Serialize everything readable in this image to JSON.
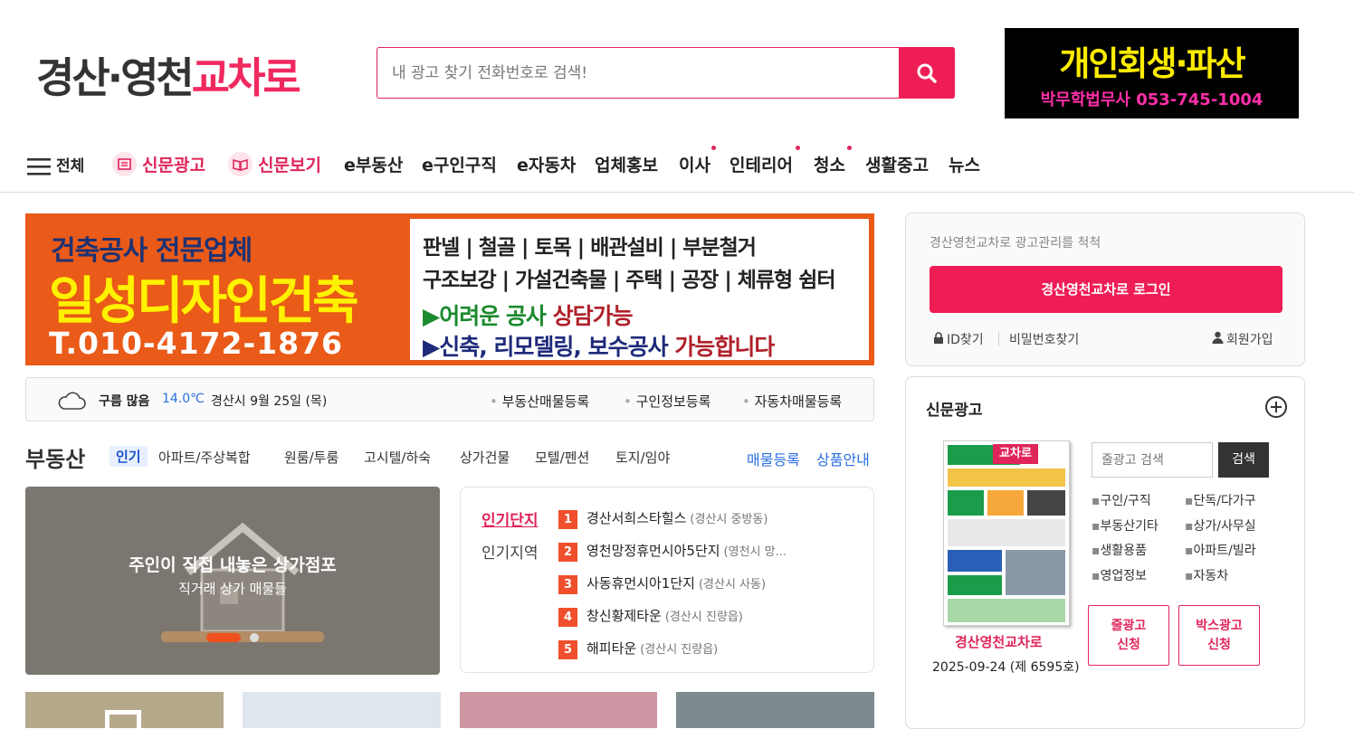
{
  "logo": {
    "part1": "경산·영천",
    "part2": "교차로"
  },
  "search": {
    "placeholder": "내 광고 찾기 전화번호로 검색!"
  },
  "top_ad": {
    "line1": "개인회생·파산",
    "line2": "박무학법무사 053-745-1004"
  },
  "nav": {
    "all": "전체",
    "items": [
      "신문광고",
      "신문보기",
      "e부동산",
      "e구인구직",
      "e자동차",
      "업체홍보",
      "이사",
      "인테리어",
      "청소",
      "생활중고",
      "뉴스"
    ]
  },
  "banner": {
    "l1": "건축공사 전문업체",
    "l2": "일성디자인건축",
    "l3": "T.010-4172-1876",
    "r1": "판넬 | 철골 | 토목 | 배관설비 | 부분철거",
    "r2": "구조보강 | 가설건축물 | 주택 | 공장 | 체류형 쉼터",
    "r3a": "▶어려운 공사 ",
    "r3b": "상담가능",
    "r4a": "▶신축, 리모델링, 보수공사 ",
    "r4b": "가능합니다"
  },
  "weather": {
    "condition": "구름 많음",
    "temp": "14.0℃",
    "location_date": "경산시 9월 25일 (목)",
    "links": [
      "부동산매물등록",
      "구인정보등록",
      "자동차매물등록"
    ]
  },
  "realestate": {
    "title": "부동산",
    "tabs": [
      "인기",
      "아파트/주상복합",
      "원룸/투룸",
      "고시텔/하숙",
      "상가건물",
      "모텔/펜션",
      "토지/임야"
    ],
    "links": [
      "매물등록",
      "상품안내"
    ],
    "promo": {
      "title": "주인이 직접 내놓은 상가점포",
      "subtitle": "직거래 상가 매물들"
    },
    "rank_tabs": [
      "인기단지",
      "인기지역"
    ],
    "ranks": [
      {
        "num": "1",
        "name": "경산서희스타힐스",
        "loc": "(경산시 중방동)"
      },
      {
        "num": "2",
        "name": "영천망정휴먼시아5단지",
        "loc": "(영천시 망..."
      },
      {
        "num": "3",
        "name": "사동휴먼시아1단지",
        "loc": "(경산시 사동)"
      },
      {
        "num": "4",
        "name": "창신황제타운",
        "loc": "(경산시 진량읍)"
      },
      {
        "num": "5",
        "name": "해피타운",
        "loc": "(경산시 진량읍)"
      }
    ]
  },
  "login": {
    "notice": "경산영천교차로 광고관리를 척척",
    "button": "경산영천교차로 로그인",
    "find_id": "ID찾기",
    "find_pw": "비밀번호찾기",
    "join": "회원가입"
  },
  "newspaper": {
    "title": "신문광고",
    "paper_name": "경산영천교차로",
    "issue": "2025-09-24 (제 6595호)",
    "search_placeholder": "줄광고 검색",
    "search_button": "검색",
    "categories": [
      "구인/구직",
      "단독/다가구",
      "부동산기타",
      "상가/사무실",
      "생활용품",
      "아파트/빌라",
      "영업정보",
      "자동차"
    ],
    "btn1_line1": "줄광고",
    "btn1_line2": "신청",
    "btn2_line1": "박스광고",
    "btn2_line2": "신청"
  },
  "colors": {
    "brand": "#f0295f",
    "accent_blue": "#2a6fe0",
    "rank": "#ef4f2c"
  }
}
